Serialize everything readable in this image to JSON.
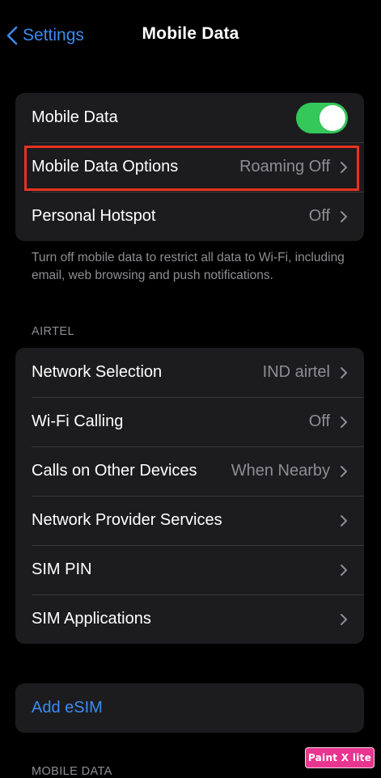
{
  "nav": {
    "back_label": "Settings",
    "title": "Mobile Data"
  },
  "group_main": {
    "mobile_data": {
      "label": "Mobile Data",
      "toggle_on": true
    },
    "options": {
      "label": "Mobile Data Options",
      "value": "Roaming Off"
    },
    "hotspot": {
      "label": "Personal Hotspot",
      "value": "Off"
    }
  },
  "footer_note": "Turn off mobile data to restrict all data to Wi-Fi, including email, web browsing and push notifications.",
  "section_carrier": "AIRTEL",
  "group_carrier": {
    "network_selection": {
      "label": "Network Selection",
      "value": "IND airtel"
    },
    "wifi_calling": {
      "label": "Wi-Fi Calling",
      "value": "Off"
    },
    "calls_other": {
      "label": "Calls on Other Devices",
      "value": "When Nearby"
    },
    "provider_services": {
      "label": "Network Provider Services"
    },
    "sim_pin": {
      "label": "SIM PIN"
    },
    "sim_apps": {
      "label": "SIM Applications"
    }
  },
  "esim": {
    "label": "Add eSIM"
  },
  "section_mobile_data": "MOBILE DATA",
  "watermark": "Paint X lite",
  "colors": {
    "accent": "#3a8cf0",
    "toggle_on": "#34c759",
    "highlight": "#e8321f",
    "cell": "#1c1c1e",
    "secondary_text": "#8e8e93"
  }
}
